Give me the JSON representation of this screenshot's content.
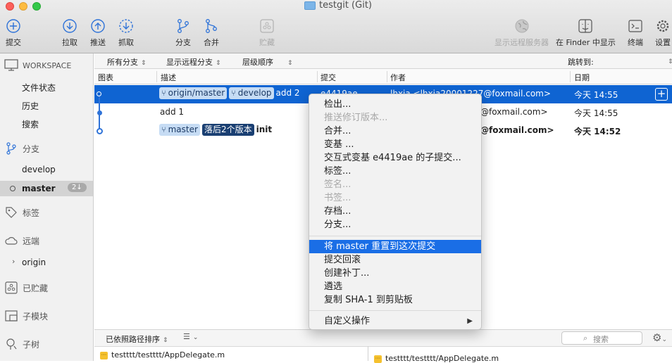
{
  "window": {
    "title": "testgit (Git)"
  },
  "toolbar": {
    "commit": "提交",
    "pull": "拉取",
    "push": "推送",
    "fetch": "抓取",
    "branch": "分支",
    "merge": "合并",
    "stash": "贮藏",
    "show_remote": "显示远程服务器",
    "show_in_finder": "在 Finder 中显示",
    "terminal": "终端",
    "settings": "设置"
  },
  "sidebar": {
    "workspace": "WORKSPACE",
    "workspace_items": [
      "文件状态",
      "历史",
      "搜索"
    ],
    "branches_label": "分支",
    "branches": [
      "develop",
      "master"
    ],
    "master_badge": "2↓",
    "tags_label": "标签",
    "remotes_label": "远端",
    "remotes": [
      "origin"
    ],
    "stashes_label": "已贮藏",
    "submodules_label": "子模块",
    "subtrees_label": "子树"
  },
  "filters": {
    "all_branches": "所有分支",
    "show_remote_branches": "显示远程分支",
    "order": "层级顺序",
    "jump_to": "跳转到:"
  },
  "columns": {
    "graph": "图表",
    "description": "描述",
    "commit": "提交",
    "author": "作者",
    "date": "日期"
  },
  "commits": [
    {
      "tags": [
        "origin/master",
        "develop"
      ],
      "message": "add 2",
      "hash": "e4419ae",
      "author": "lhxia <lhxia20001227@foxmail.com>",
      "date": "今天 14:55"
    },
    {
      "tags": [],
      "message": "add 1",
      "hash": "",
      "author": "@foxmail.com>",
      "date": "今天 14:55"
    },
    {
      "tags": [
        "master"
      ],
      "behind": "落后2个版本",
      "message": "init",
      "hash": "",
      "author": "@foxmail.com>",
      "date": "今天 14:52"
    }
  ],
  "context_menu": {
    "items": [
      {
        "label": "检出...",
        "enabled": true
      },
      {
        "label": "推送修订版本...",
        "enabled": false
      },
      {
        "label": "合并...",
        "enabled": true
      },
      {
        "label": "变基 ...",
        "enabled": true
      },
      {
        "label": "交互式变基 e4419ae 的子提交...",
        "enabled": true
      },
      {
        "label": "标签...",
        "enabled": true
      },
      {
        "label": "签名...",
        "enabled": false
      },
      {
        "label": "书签...",
        "enabled": false
      },
      {
        "label": "存档...",
        "enabled": true
      },
      {
        "label": "分支...",
        "enabled": true
      }
    ],
    "items2": [
      {
        "label": "将 master 重置到这次提交",
        "highlight": true
      },
      {
        "label": "提交回滚"
      },
      {
        "label": "创建补丁..."
      },
      {
        "label": "遴选"
      },
      {
        "label": "复制 SHA-1 到剪贴板"
      }
    ],
    "custom": "自定义操作"
  },
  "bottom": {
    "sort": "已依照路径排序",
    "search_placeholder": "搜索",
    "left_file": "testttt/testttt/AppDelegate.m",
    "right_file": "testttt/testttt/AppDelegate.m"
  }
}
